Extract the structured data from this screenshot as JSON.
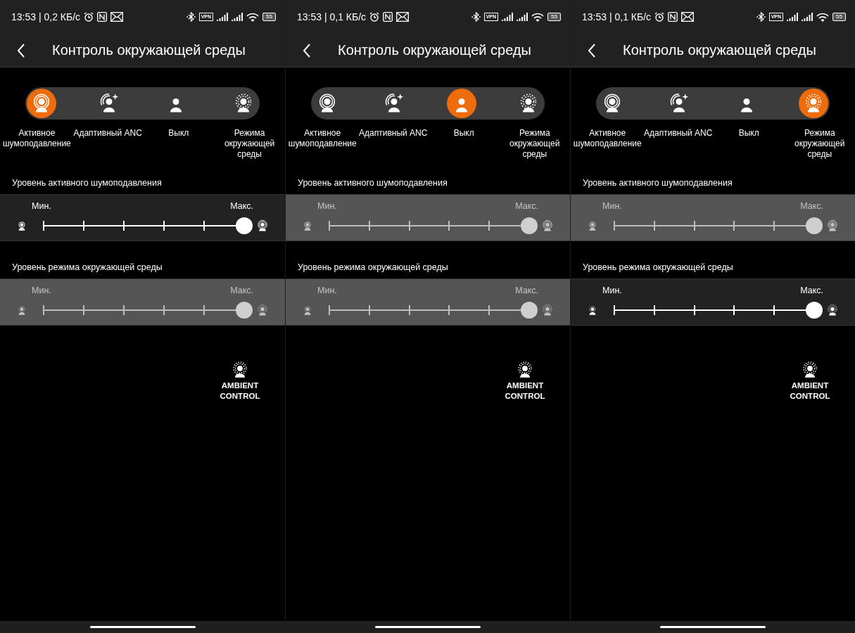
{
  "screens": [
    {
      "status_bar": {
        "time_speed": "13:53 | 0,2 КБ/с",
        "vpn": "VPN",
        "battery": "55"
      },
      "title": "Контроль окружающей среды",
      "modes": [
        {
          "kind": "anc",
          "label": "Активное шумоподавление",
          "selected": true
        },
        {
          "kind": "adaptive",
          "label": "Адаптивный ANC",
          "selected": false
        },
        {
          "kind": "off",
          "label": "Выкл",
          "selected": false
        },
        {
          "kind": "ambient",
          "label": "Режима окружающей среды",
          "selected": false
        }
      ],
      "sliders": [
        {
          "kind": "anc",
          "title": "Уровень активного шумоподавления",
          "min_label": "Мин.",
          "max_label": "Макс.",
          "enabled": true,
          "level": 1
        },
        {
          "kind": "ambient",
          "title": "Уровень режима окружающей среды",
          "min_label": "Мин.",
          "max_label": "Макс.",
          "enabled": false,
          "level": 1
        }
      ],
      "logo": {
        "line_1": "AMBIENT",
        "line_2": "CONTROL"
      }
    },
    {
      "status_bar": {
        "time_speed": "13:53 | 0,1 КБ/с",
        "vpn": "VPN",
        "battery": "55"
      },
      "title": "Контроль окружающей среды",
      "modes": [
        {
          "kind": "anc",
          "label": "Активное шумоподавление",
          "selected": false
        },
        {
          "kind": "adaptive",
          "label": "Адаптивный ANC",
          "selected": false
        },
        {
          "kind": "off",
          "label": "Выкл",
          "selected": true
        },
        {
          "kind": "ambient",
          "label": "Режима окружающей среды",
          "selected": false
        }
      ],
      "sliders": [
        {
          "kind": "anc",
          "title": "Уровень активного шумоподавления",
          "min_label": "Мин.",
          "max_label": "Макс.",
          "enabled": false,
          "level": 1
        },
        {
          "kind": "ambient",
          "title": "Уровень режима окружающей среды",
          "min_label": "Мин.",
          "max_label": "Макс.",
          "enabled": false,
          "level": 1
        }
      ],
      "logo": {
        "line_1": "AMBIENT",
        "line_2": "CONTROL"
      }
    },
    {
      "status_bar": {
        "time_speed": "13:53 | 0,1 КБ/с",
        "vpn": "VPN",
        "battery": "55"
      },
      "title": "Контроль окружающей среды",
      "modes": [
        {
          "kind": "anc",
          "label": "Активное шумоподавление",
          "selected": false
        },
        {
          "kind": "adaptive",
          "label": "Адаптивный ANC",
          "selected": false
        },
        {
          "kind": "off",
          "label": "Выкл",
          "selected": false
        },
        {
          "kind": "ambient",
          "label": "Режима окружающей среды",
          "selected": true
        }
      ],
      "sliders": [
        {
          "kind": "anc",
          "title": "Уровень активного шумоподавления",
          "min_label": "Мин.",
          "max_label": "Макс.",
          "enabled": false,
          "level": 1
        },
        {
          "kind": "ambient",
          "title": "Уровень режима окружающей среды",
          "min_label": "Мин.",
          "max_label": "Макс.",
          "enabled": true,
          "level": 1
        }
      ],
      "logo": {
        "line_1": "AMBIENT",
        "line_2": "CONTROL"
      }
    }
  ]
}
